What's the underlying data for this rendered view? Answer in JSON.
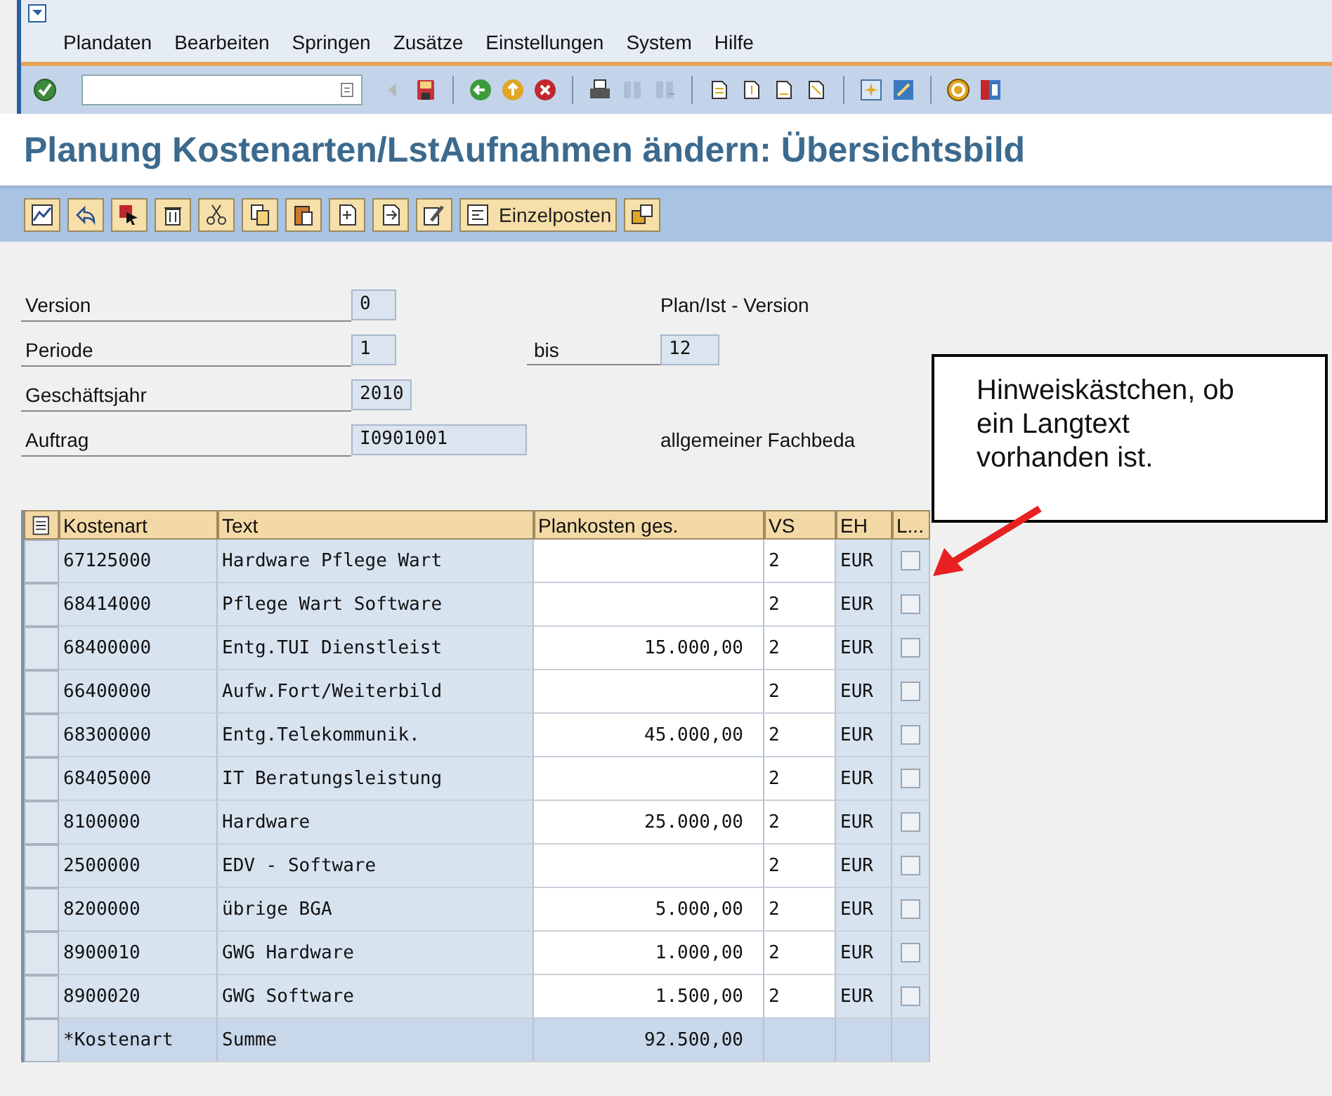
{
  "menu": [
    "Plandaten",
    "Bearbeiten",
    "Springen",
    "Zusätze",
    "Einstellungen",
    "System",
    "Hilfe"
  ],
  "title": "Planung Kostenarten/LstAufnahmen ändern: Übersichtsbild",
  "app_toolbar": {
    "button_label": "Einzelposten"
  },
  "form": {
    "fields": [
      {
        "label": "Version",
        "value": "0"
      },
      {
        "label": "Periode",
        "value": "1"
      },
      {
        "label": "Geschäftsjahr",
        "value": "2010"
      },
      {
        "label": "Auftrag",
        "value": "I0901001"
      }
    ],
    "version_text": "Plan/Ist - Version",
    "to_label": "bis",
    "to_value": "12",
    "order_text": "allgemeiner Fachbeda"
  },
  "table": {
    "columns": [
      "Kostenart",
      "Text",
      "Plankosten ges.",
      "VS",
      "EH",
      "L..."
    ],
    "rows": [
      {
        "kind": "item",
        "cells": [
          "67125000",
          "Hardware Pflege Wart",
          "",
          "2",
          "EUR"
        ],
        "checked": false
      },
      {
        "kind": "item",
        "cells": [
          "68414000",
          "Pflege Wart Software",
          "",
          "2",
          "EUR"
        ],
        "checked": false
      },
      {
        "kind": "item",
        "cells": [
          "68400000",
          "Entg.TUI Dienstleist",
          "15.000,00",
          "2",
          "EUR"
        ],
        "checked": false
      },
      {
        "kind": "item",
        "cells": [
          "66400000",
          "Aufw.Fort/Weiterbild",
          "",
          "2",
          "EUR"
        ],
        "checked": false
      },
      {
        "kind": "item",
        "cells": [
          "68300000",
          "Entg.Telekommunik.",
          "45.000,00",
          "2",
          "EUR"
        ],
        "checked": false
      },
      {
        "kind": "item",
        "cells": [
          "68405000",
          "IT Beratungsleistung",
          "",
          "2",
          "EUR"
        ],
        "checked": false
      },
      {
        "kind": "item",
        "cells": [
          "8100000",
          "Hardware",
          "25.000,00",
          "2",
          "EUR"
        ],
        "checked": false
      },
      {
        "kind": "item",
        "cells": [
          "2500000",
          "EDV - Software",
          "",
          "2",
          "EUR"
        ],
        "checked": false
      },
      {
        "kind": "item",
        "cells": [
          "8200000",
          "übrige BGA",
          "5.000,00",
          "2",
          "EUR"
        ],
        "checked": false
      },
      {
        "kind": "item",
        "cells": [
          "8900010",
          "GWG Hardware",
          "1.000,00",
          "2",
          "EUR"
        ],
        "checked": false
      },
      {
        "kind": "item",
        "cells": [
          "8900020",
          "GWG Software",
          "1.500,00",
          "2",
          "EUR"
        ],
        "checked": false
      },
      {
        "kind": "total",
        "cells": [
          "*Kostenart",
          "Summe",
          "92.500,00",
          "",
          ""
        ]
      }
    ]
  },
  "callout": {
    "text": "Hinweiskästchen, ob ein Langtext vorhanden ist."
  }
}
